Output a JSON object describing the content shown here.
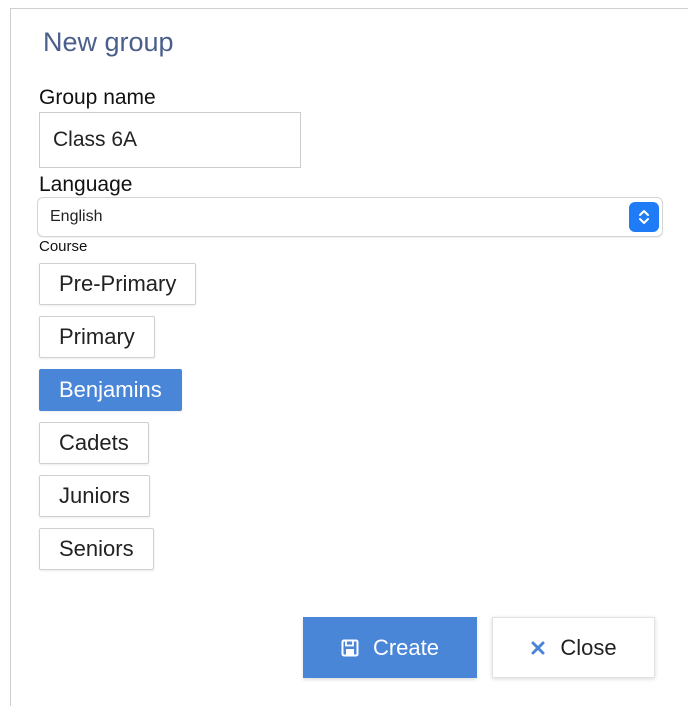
{
  "dialog": {
    "title": "New group"
  },
  "form": {
    "group_name_label": "Group name",
    "group_name_value": "Class 6A",
    "language_label": "Language",
    "language_selected": "English",
    "course_label": "Course"
  },
  "courses": [
    {
      "label": "Pre-Primary",
      "selected": false
    },
    {
      "label": "Primary",
      "selected": false
    },
    {
      "label": "Benjamins",
      "selected": true
    },
    {
      "label": "Cadets",
      "selected": false
    },
    {
      "label": "Juniors",
      "selected": false
    },
    {
      "label": "Seniors",
      "selected": false
    }
  ],
  "actions": {
    "create_label": "Create",
    "create_icon": "save-icon",
    "close_label": "Close",
    "close_icon": "close-icon"
  },
  "colors": {
    "accent": "#4a86d8",
    "title": "#4a5f8c",
    "select_stepper": "#1f7cf6",
    "close_icon": "#4a86d8"
  }
}
